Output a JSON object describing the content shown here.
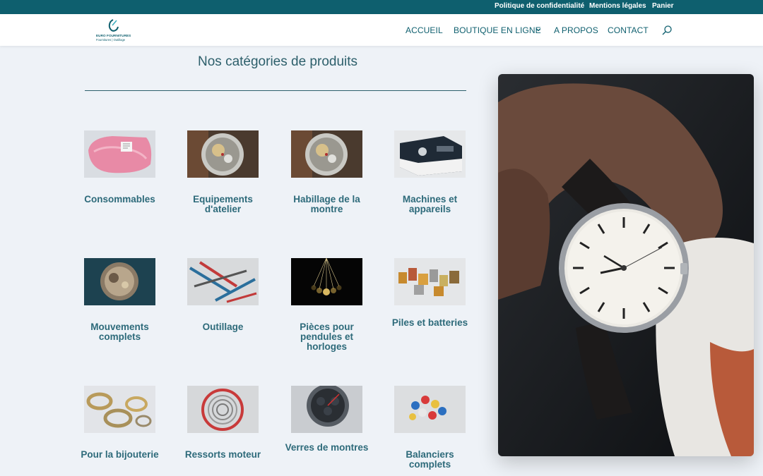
{
  "topbar": {
    "links": [
      "Politique de confidentialité",
      "Mentions légales",
      "Panier"
    ]
  },
  "logo": {
    "brand": "EURO FOURNITURES",
    "tagline": "Fournitures | Outillage"
  },
  "nav": {
    "items": [
      "ACCUEIL",
      "BOUTIQUE EN LIGNE",
      "A PROPOS",
      "CONTACT"
    ]
  },
  "section": {
    "title": "Nos catégories de produits"
  },
  "categories": [
    {
      "label": "Consommables",
      "icon": "pink-consumables-bag"
    },
    {
      "label": "Equipements d'atelier",
      "icon": "watch-movement"
    },
    {
      "label": "Habillage de la montre",
      "icon": "watch-movement"
    },
    {
      "label": "Machines et appareils",
      "icon": "machine-box"
    },
    {
      "label": "Mouvements complets",
      "icon": "movement-plate"
    },
    {
      "label": "Outillage",
      "icon": "tools"
    },
    {
      "label": "Pièces pour pendules et horloges",
      "icon": "pendulum"
    },
    {
      "label": "Piles et batteries",
      "icon": "batteries"
    },
    {
      "label": "Pour la bijouterie",
      "icon": "bracelets"
    },
    {
      "label": "Ressorts moteur",
      "icon": "mainspring"
    },
    {
      "label": "Verres de montres",
      "icon": "chronograph"
    },
    {
      "label": "Balanciers complets",
      "icon": "balance-wheels"
    }
  ],
  "hero": {
    "icon": "wristwatch-photo"
  },
  "colors": {
    "topbar": "#0e5f6e",
    "accent": "#2d6a7a",
    "background": "#eef2f7"
  }
}
